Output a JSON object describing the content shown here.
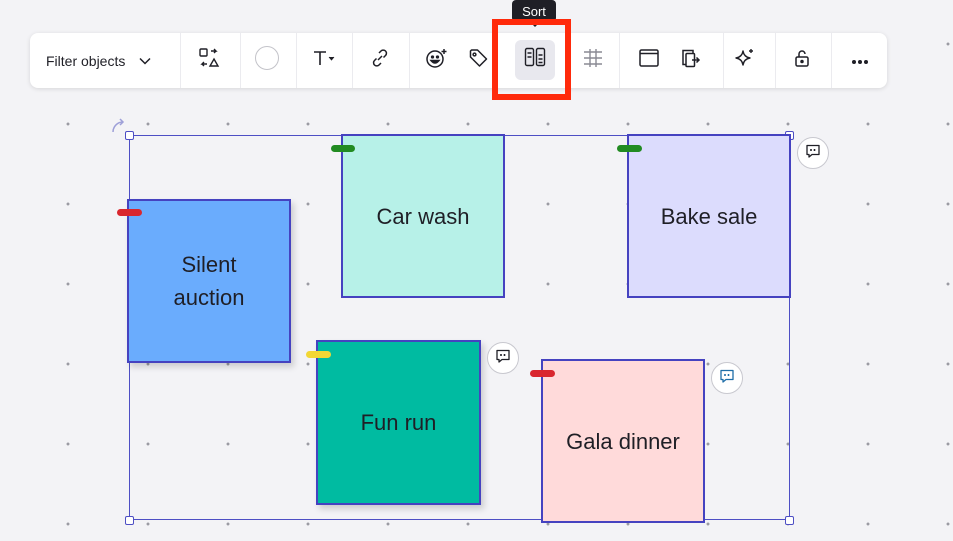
{
  "toolbar": {
    "filter_label": "Filter objects",
    "icons": [
      "switch-type-icon",
      "color-circle-icon",
      "text-icon",
      "link-icon",
      "reaction-icon",
      "tag-icon",
      "sort-icon",
      "grid-align-icon",
      "frame-icon",
      "export-icon",
      "ai-sparkle-icon",
      "lock-icon",
      "more-icon"
    ],
    "active_item": "sort"
  },
  "tooltip": {
    "text": "Sort"
  },
  "notes": [
    {
      "label": "Silent auction",
      "color": "#6aacfd",
      "tag_color": "#d9262e"
    },
    {
      "label": "Car wash",
      "color": "#b7f1e8",
      "tag_color": "#228b22"
    },
    {
      "label": "Bake sale",
      "color": "#dcdcfd",
      "tag_color": "#228b22"
    },
    {
      "label": "Fun run",
      "color": "#00bba1",
      "tag_color": "#f2d735"
    },
    {
      "label": "Gala dinner",
      "color": "#ffdada",
      "tag_color": "#d9262e"
    }
  ],
  "colors": {
    "selection": "#4d4ec4",
    "highlight": "#ff2a0b"
  }
}
